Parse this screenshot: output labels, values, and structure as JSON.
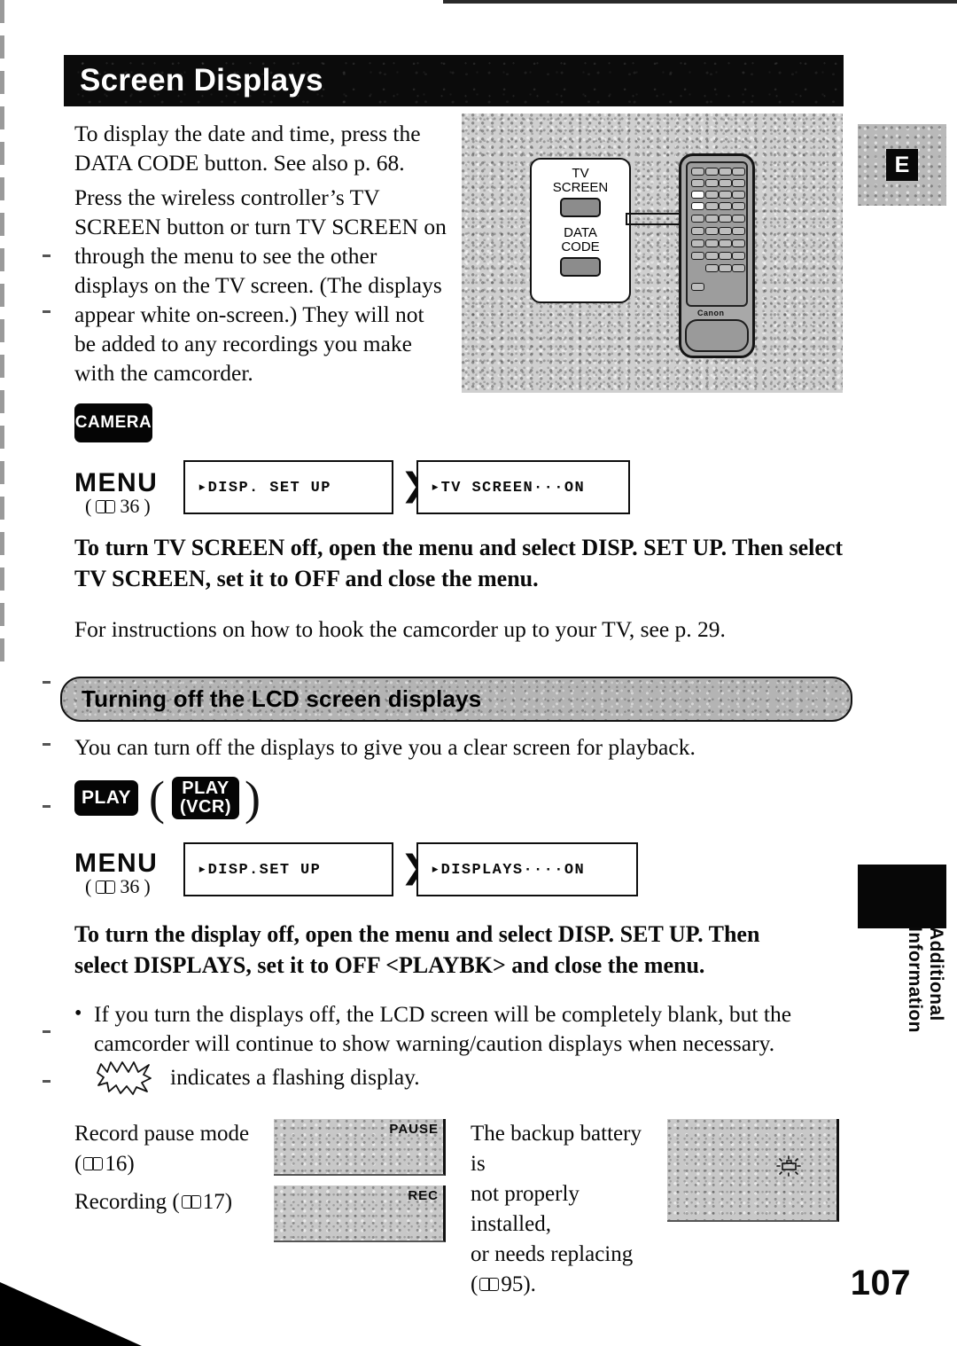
{
  "document": {
    "page_number": "107",
    "language_marker": "E",
    "side_tab_label": "Additional Information"
  },
  "main_section": {
    "heading": "Screen Displays",
    "paragraph_1": "To display the date and time, press the DATA CODE button. See also p. 68.",
    "paragraph_2": "Press the wireless controller’s TV SCREEN button or turn TV SCREEN on through the menu to see the other displays on the TV screen. (The displays appear white on-screen.) They will not be added to any recordings you make with the camcorder.",
    "illustration": {
      "callout_button_1": "TV\nSCREEN",
      "callout_button_2": "DATA\nCODE",
      "remote_brand": "Canon"
    },
    "mode_badge": "CAMERA",
    "menu": {
      "label": "MENU",
      "page_ref": "36",
      "step_1": "▸DISP. SET UP",
      "step_2": "▸TV SCREEN···ON",
      "arrow": "❯❯"
    },
    "instruction_bold": "To turn TV SCREEN off, open the menu and select DISP. SET UP. Then select TV SCREEN, set it to OFF and close the menu.",
    "note": "For instructions on how to hook the camcorder up to your TV, see p. 29."
  },
  "lcd_section": {
    "heading": "Turning off the LCD screen displays",
    "intro": "You can turn off the displays to give you a clear screen for playback.",
    "mode_badge_1": "PLAY",
    "mode_badge_2_line1": "PLAY",
    "mode_badge_2_line2": "(VCR)",
    "paren_open": "(",
    "paren_close": ")",
    "menu": {
      "label": "MENU",
      "page_ref": "36",
      "step_1": "▸DISP.SET UP",
      "step_2": "▸DISPLAYS····ON",
      "arrow": "❯❯"
    },
    "instruction_bold": "To turn the display off, open the menu and select DISP. SET UP. Then select DISPLAYS, set it to OFF <PLAYBK> and close the menu.",
    "bullet_1": "If you turn the displays off, the LCD screen will be completely blank, but the camcorder will continue to show warning/caution displays when necessary.",
    "bullet_marker": "•",
    "flash_note": "indicates a flashing display."
  },
  "examples": [
    {
      "caption_line_1": "Record pause mode",
      "caption_line_2_prefix": "(",
      "caption_page_ref": "16",
      "caption_line_2_suffix": ")",
      "screen_label": "PAUSE"
    },
    {
      "caption_line_1": "Recording (",
      "caption_page_ref": "17",
      "caption_line_2_suffix": ")",
      "screen_label": "REC"
    },
    {
      "caption_line_1": "The backup battery is",
      "caption_line_2": "not properly installed,",
      "caption_line_3": "or needs replacing",
      "caption_line_4_prefix": "(",
      "caption_page_ref": "95",
      "caption_line_4_suffix": ").",
      "screen_label": ""
    }
  ],
  "colors": {
    "ink": "#0a0a0a",
    "banner_bg": "#0b0b0b",
    "subbanner_bg": "#b4b4b4",
    "lcd_gray": "#c8c8c8",
    "illustration_gray": "#cfcfcf"
  }
}
